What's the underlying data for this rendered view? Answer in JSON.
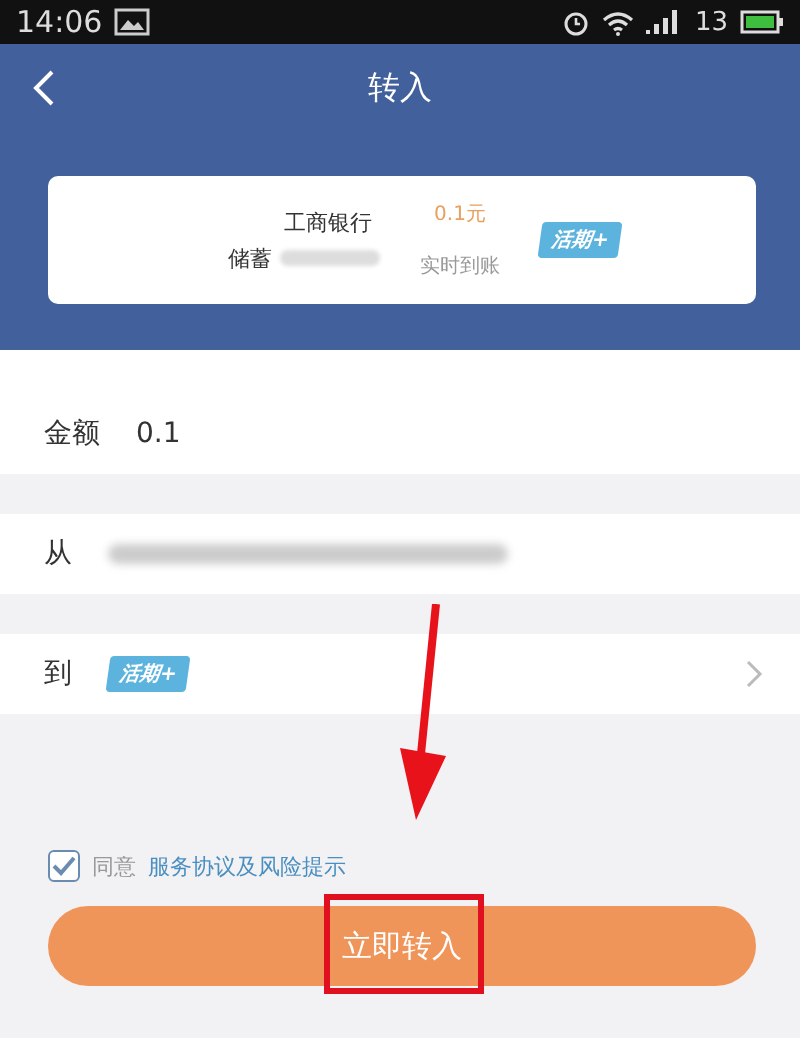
{
  "status_bar": {
    "time": "14:06",
    "signal_text": "13"
  },
  "header": {
    "title": "转入"
  },
  "card": {
    "bank": "工商银行",
    "account_label": "储蓄",
    "amount": "0.1元",
    "arrival": "实时到账",
    "tag": "活期+"
  },
  "form": [
    {
      "kind": "input",
      "label": "金额",
      "value": "0.1"
    },
    {
      "kind": "blurred",
      "label": "从"
    },
    {
      "kind": "tag",
      "label": "到",
      "tag": "活期+"
    }
  ],
  "agreement": {
    "checked": true,
    "prefix": "同意",
    "link": "服务协议及风险提示"
  },
  "submit_button": "立即转入"
}
